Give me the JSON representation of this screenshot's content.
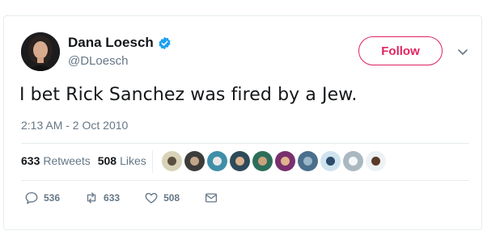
{
  "tweet": {
    "author_name": "Dana Loesch",
    "author_handle": "@DLoesch",
    "follow_label": "Follow",
    "text": "I bet Rick Sanchez was fired by a Jew.",
    "timestamp": "2:13 AM - 2 Oct 2010"
  },
  "stats": {
    "retweets_count": "633",
    "retweets_label": "Retweets",
    "likes_count": "508",
    "likes_label": "Likes"
  },
  "liker_avatars": [
    {
      "bg": "#d8d2b8",
      "head": "#5a5040"
    },
    {
      "bg": "#3c3c3a",
      "head": "#c4a58a"
    },
    {
      "bg": "#3f8fa8",
      "head": "#e8e8e8"
    },
    {
      "bg": "#2e4a5a",
      "head": "#d9b08c"
    },
    {
      "bg": "#2c6e5a",
      "head": "#c9a27e"
    },
    {
      "bg": "#7a2f6e",
      "head": "#e0b48e"
    },
    {
      "bg": "#4a6f8c",
      "head": "#9ab6c8"
    },
    {
      "bg": "#cfe3ef",
      "head": "#2c4a6a"
    },
    {
      "bg": "#aab8c2",
      "head": "#f5f8fa"
    },
    {
      "bg": "#eef2f5",
      "head": "#5b3a28"
    }
  ],
  "actions": {
    "reply_count": "536",
    "retweet_count": "633",
    "like_count": "508"
  },
  "colors": {
    "follow_accent": "#e0245e",
    "verified_blue": "#1da1f2",
    "muted_text": "#657786"
  },
  "icons": [
    "verified-badge-icon",
    "chevron-down-icon",
    "reply-icon",
    "retweet-icon",
    "heart-icon",
    "direct-message-icon"
  ]
}
